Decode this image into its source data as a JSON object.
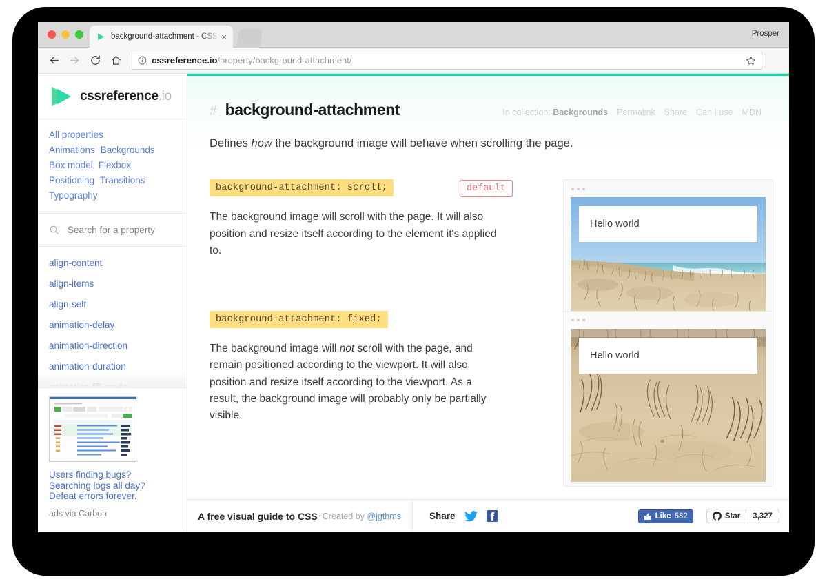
{
  "browser": {
    "profile_name": "Prosper",
    "tab": {
      "title": "background-attachment - CSS",
      "close_label": "×",
      "favicon_name": "cssreference-play-logo"
    },
    "url": {
      "domain": "cssreference.io",
      "path": "/property/background-attachment/"
    }
  },
  "sidebar": {
    "logo": {
      "name": "cssreference",
      "tld": ".io"
    },
    "collections": [
      {
        "label": "All properties"
      },
      {
        "label": "Animations"
      },
      {
        "label": "Backgrounds"
      },
      {
        "label": "Box model"
      },
      {
        "label": "Flexbox"
      },
      {
        "label": "Positioning"
      },
      {
        "label": "Transitions"
      },
      {
        "label": "Typography"
      }
    ],
    "search": {
      "placeholder": "Search for a property",
      "value": ""
    },
    "properties": [
      "align-content",
      "align-items",
      "align-self",
      "animation-delay",
      "animation-direction",
      "animation-duration",
      "animation-fill-mode"
    ],
    "ad": {
      "lines": [
        "Users finding bugs?",
        "Searching logs all day?",
        "Defeat errors forever."
      ],
      "via": "ads via Carbon"
    }
  },
  "main": {
    "hash": "#",
    "title": "background-attachment",
    "meta": {
      "collection_prefix": "In collection:",
      "collection_name": "Backgrounds",
      "links": [
        "Permalink",
        "Share",
        "Can I use",
        "MDN"
      ]
    },
    "intro": {
      "before": "Defines ",
      "emphasis": "how",
      "after": " the background image will behave when scrolling the page."
    },
    "sections": [
      {
        "code": "background-attachment: scroll;",
        "badge": "default",
        "description_parts": [
          {
            "text": "The background image will scroll with the page. It will also position and resize itself according to the element it's applied to.",
            "em": false
          }
        ],
        "demo": {
          "hello_text": "Hello world",
          "scene": "beach-dune-wide"
        }
      },
      {
        "code": "background-attachment: fixed;",
        "badge": "",
        "description_parts": [
          {
            "text": "The background image will ",
            "em": false
          },
          {
            "text": "not",
            "em": true
          },
          {
            "text": " scroll with the page, and remain positioned according to the viewport. It will also position and resize itself according to the viewport. As a result, the background image will probably only be partially visible.",
            "em": false
          }
        ],
        "demo": {
          "hello_text": "Hello world",
          "scene": "beach-dune-zoom"
        }
      }
    ]
  },
  "footer": {
    "title": "A free visual guide to CSS",
    "created_by_prefix": "Created by",
    "created_by_handle": "@jgthms",
    "share_label": "Share",
    "facebook_like": {
      "label": "Like",
      "count": "582"
    },
    "github_star": {
      "label": "Star",
      "count": "3,327"
    }
  },
  "colors": {
    "accent_teal": "#1ed2a8",
    "code_highlight": "#ffde80",
    "default_badge": "#ef6a6a",
    "link_blue": "#4a6fd4",
    "facebook_blue": "#4267b2",
    "twitter_blue": "#1da1f2"
  }
}
